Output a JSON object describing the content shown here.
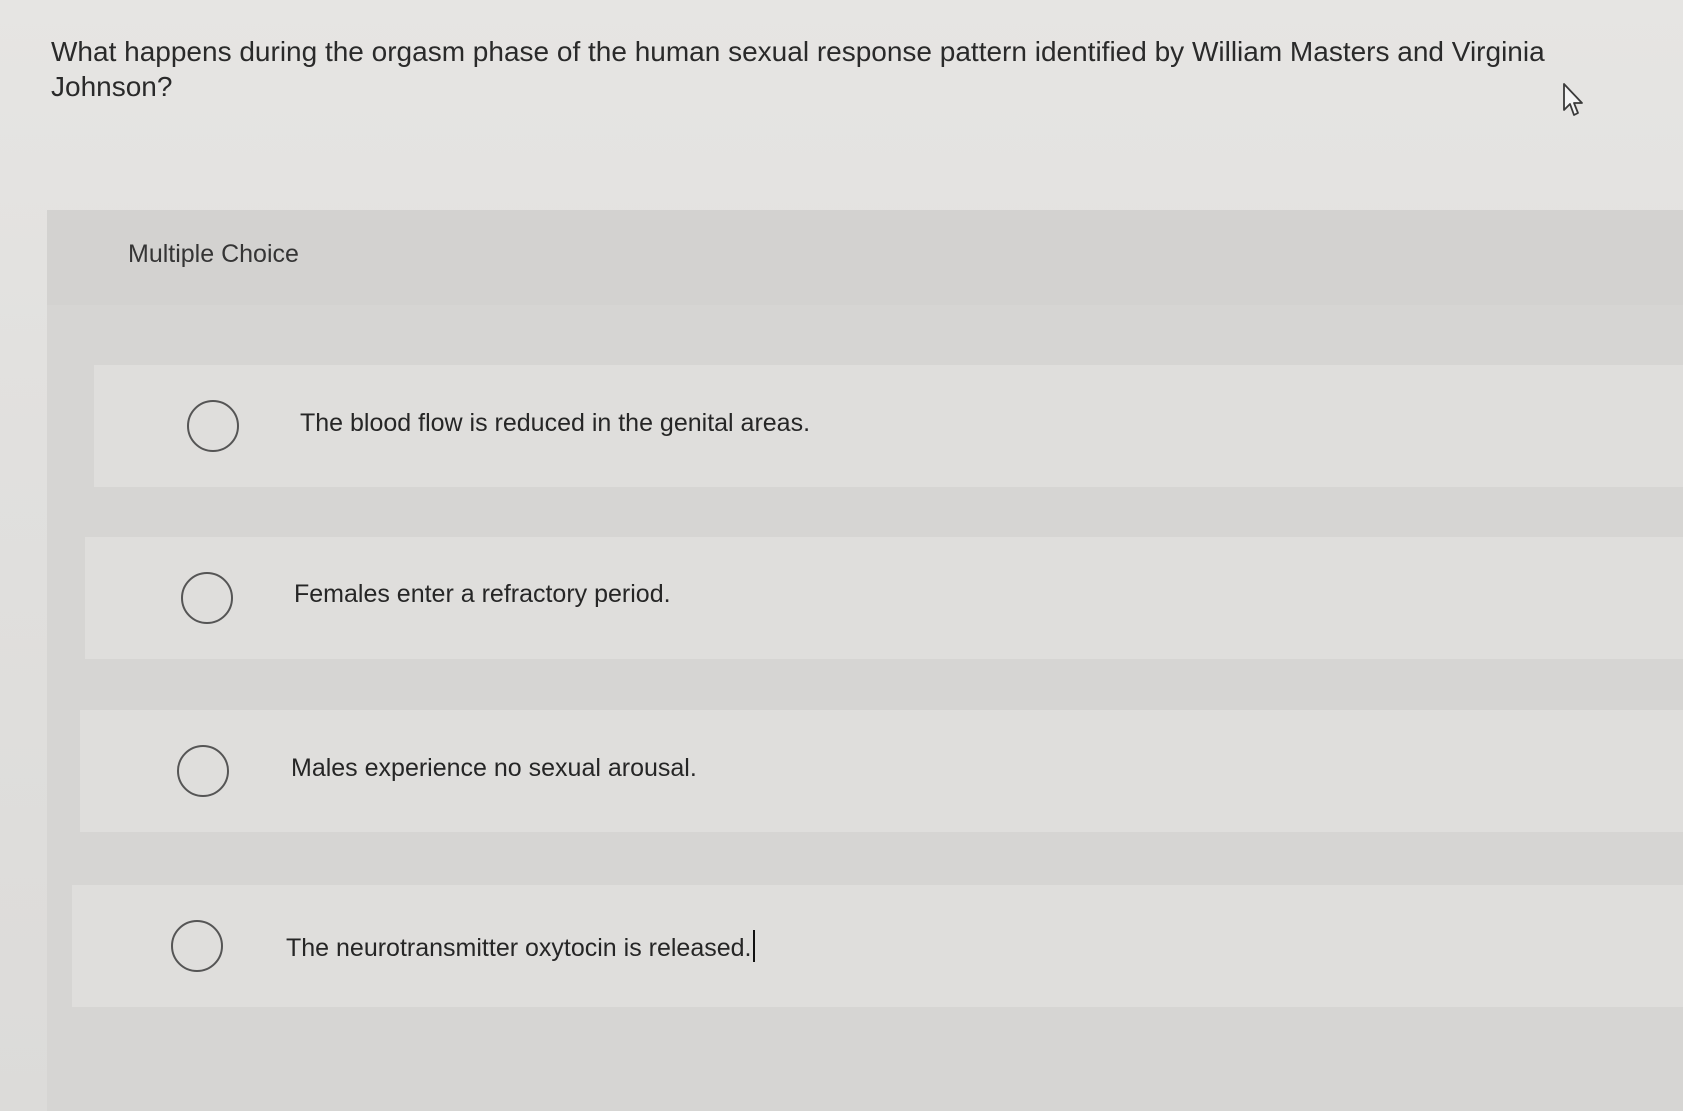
{
  "question": {
    "text": "What happens during the orgasm phase of the human sexual response pattern identified by William Masters and Virginia Johnson?"
  },
  "panel": {
    "label": "Multiple Choice"
  },
  "options": [
    {
      "label": "The blood flow is reduced in the genital areas.",
      "selected": false
    },
    {
      "label": "Females enter a refractory period.",
      "selected": false
    },
    {
      "label": "Males experience no sexual arousal.",
      "selected": false
    },
    {
      "label": "The neurotransmitter oxytocin is released.",
      "selected": false
    }
  ],
  "icons": {
    "pointer": "mouse-pointer-icon",
    "radio": "radio-circle-icon"
  }
}
